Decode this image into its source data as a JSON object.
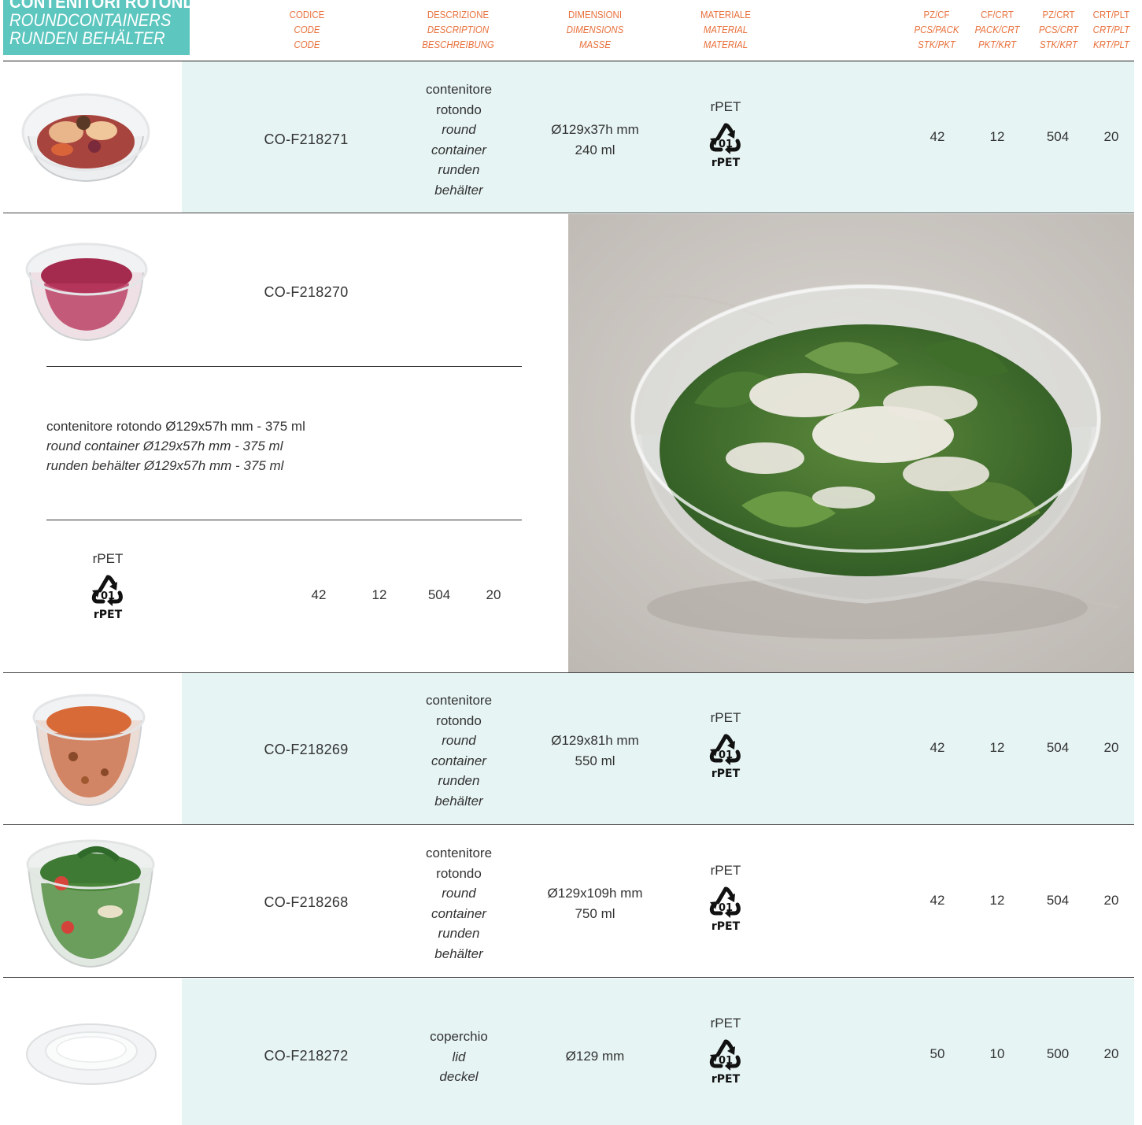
{
  "title": {
    "line1": "CONTENITORI ROTONDI",
    "line2": "ROUNDCONTAINERS",
    "line3": "RUNDEN BEHÄLTER"
  },
  "headers": {
    "code": [
      "CODICE",
      "CODE",
      "CODE"
    ],
    "description": [
      "DESCRIZIONE",
      "DESCRIPTION",
      "BESCHREIBUNG"
    ],
    "dimensions": [
      "DIMENSIONI",
      "DIMENSIONS",
      "MASSE"
    ],
    "material": [
      "MATERIALE",
      "MATERIAL",
      "MATERIAL"
    ],
    "pz_cf": [
      "PZ/CF",
      "PCS/PACK",
      "STK/PKT"
    ],
    "cf_crt": [
      "CF/CRT",
      "PACK/CRT",
      "PKT/KRT"
    ],
    "pz_crt": [
      "PZ/CRT",
      "PCS/CRT",
      "STK/KRT"
    ],
    "crt_plt": [
      "CRT/PLT",
      "CRT/PLT",
      "KRT/PLT"
    ]
  },
  "material_symbol": {
    "number": "01",
    "label": "rPET"
  },
  "rows": [
    {
      "code": "CO-F218271",
      "desc_it": [
        "contenitore",
        "rotondo"
      ],
      "desc_en": [
        "round",
        "container"
      ],
      "desc_de": [
        "runden",
        "behälter"
      ],
      "dim": [
        "Ø129x37h mm",
        "240 ml"
      ],
      "material": "rPET",
      "pz_cf": "42",
      "cf_crt": "12",
      "pz_crt": "504",
      "crt_plt": "20"
    },
    {
      "code": "CO-F218269",
      "desc_it": [
        "contenitore",
        "rotondo"
      ],
      "desc_en": [
        "round",
        "container"
      ],
      "desc_de": [
        "runden",
        "behälter"
      ],
      "dim": [
        "Ø129x81h mm",
        "550 ml"
      ],
      "material": "rPET",
      "pz_cf": "42",
      "cf_crt": "12",
      "pz_crt": "504",
      "crt_plt": "20"
    },
    {
      "code": "CO-F218268",
      "desc_it": [
        "contenitore",
        "rotondo"
      ],
      "desc_en": [
        "round",
        "container"
      ],
      "desc_de": [
        "runden",
        "behälter"
      ],
      "dim": [
        "Ø129x109h mm",
        "750 ml"
      ],
      "material": "rPET",
      "pz_cf": "42",
      "cf_crt": "12",
      "pz_crt": "504",
      "crt_plt": "20"
    },
    {
      "code": "CO-F218272",
      "desc_it": [
        "coperchio"
      ],
      "desc_en": [
        "lid"
      ],
      "desc_de": [
        "deckel"
      ],
      "dim": [
        "Ø129 mm"
      ],
      "material": "rPET",
      "pz_cf": "50",
      "cf_crt": "10",
      "pz_crt": "500",
      "crt_plt": "20"
    }
  ],
  "featured": {
    "code": "CO-F218270",
    "desc_it": "contenitore rotondo Ø129x57h mm - 375 ml",
    "desc_en": "round container Ø129x57h mm - 375 ml",
    "desc_de": "runden behälter Ø129x57h mm - 375 ml",
    "material": "rPET",
    "pz_cf": "42",
    "cf_crt": "12",
    "pz_crt": "504",
    "crt_plt": "20"
  },
  "colors": {
    "accent": "#e8703b",
    "title_bg": "#5cc6bf",
    "row_tint": "#e6f4f3"
  }
}
